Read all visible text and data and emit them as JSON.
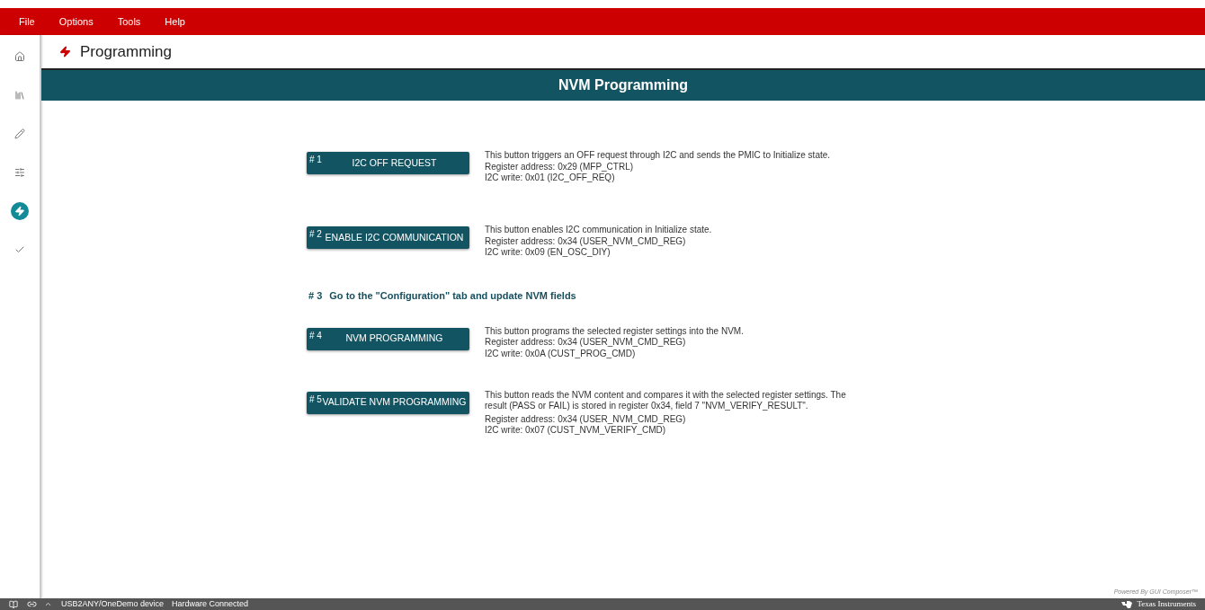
{
  "menu": [
    "File",
    "Options",
    "Tools",
    "Help"
  ],
  "sidebar": {
    "items": [
      {
        "kind": "home",
        "selected": false
      },
      {
        "kind": "library",
        "selected": false
      },
      {
        "kind": "pencil",
        "selected": false
      },
      {
        "kind": "sliders",
        "selected": false
      },
      {
        "kind": "bolt",
        "selected": true
      },
      {
        "kind": "check",
        "selected": false
      }
    ]
  },
  "page_title": "Programming",
  "panel": {
    "title": "NVM Programming",
    "steps": [
      {
        "kind": "button",
        "number": "# 1",
        "label": "I2C OFF REQUEST",
        "description": [
          "This button triggers an OFF request through I2C and sends the PMIC to Initialize state.",
          "Register address: 0x29 (MFP_CTRL)",
          "I2C write: 0x01 (I2C_OFF_REQ)"
        ]
      },
      {
        "kind": "button",
        "number": "# 2",
        "label": "ENABLE I2C COMMUNICATION",
        "description": [
          "This button enables I2C communication in Initialize state.",
          "Register address: 0x34 (USER_NVM_CMD_REG)",
          "I2C write: 0x09 (EN_OSC_DIY)"
        ]
      },
      {
        "kind": "instruction",
        "number": "# 3",
        "label": "Go to the \"Configuration\" tab and update NVM fields"
      },
      {
        "kind": "button",
        "number": "# 4",
        "label": "NVM PROGRAMMING",
        "description": [
          "This button programs the selected register settings into the NVM.",
          "Register address: 0x34 (USER_NVM_CMD_REG)",
          "I2C write: 0x0A (CUST_PROG_CMD)"
        ]
      },
      {
        "kind": "button",
        "number": "# 5",
        "label": "VALIDATE NVM PROGRAMMING",
        "description": [
          "This button reads the NVM content and compares it with the selected register settings. The result (PASS or FAIL) is stored in register 0x34, field 7 \"NVM_VERIFY_RESULT\".",
          "Register address: 0x34 (USER_NVM_CMD_REG)",
          "I2C write: 0x07 (CUST_NVM_VERIFY_CMD)"
        ]
      }
    ]
  },
  "powered_by": "Powered By GUI Composer™",
  "status_bar": {
    "device": "USB2ANY/OneDemo device",
    "connection": "Hardware Connected",
    "brand": "Texas Instruments"
  }
}
